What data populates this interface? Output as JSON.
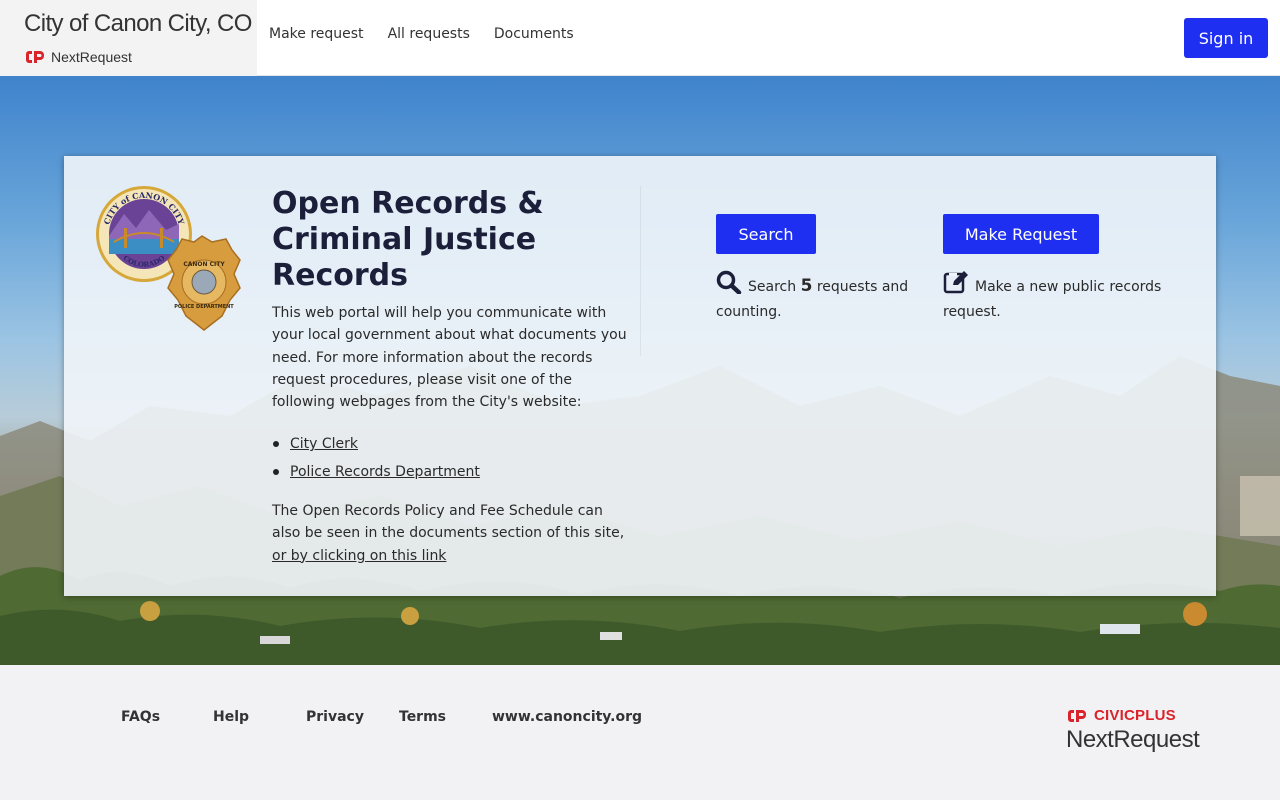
{
  "header": {
    "org_title": "City of Canon City, CO",
    "product_name": "NextRequest",
    "nav": [
      {
        "label": "Make request"
      },
      {
        "label": "All requests"
      },
      {
        "label": "Documents"
      }
    ],
    "signin_label": "Sign in"
  },
  "hero": {
    "title": "Open Records & Criminal Justice Records",
    "intro": "This web portal will help you communicate with your local government about what documents you need. For more information about the records request procedures, please visit one of the following webpages from the City's website:",
    "links": [
      {
        "label": "City Clerk"
      },
      {
        "label": "Police Records Department"
      }
    ],
    "policy_text": "The Open Records Policy and Fee Schedule can also be seen in the documents section of this site, ",
    "policy_link": "or by clicking on this link",
    "seal_text": {
      "city_top": "CITY of CANON CITY",
      "city_bottom": "COLORADO",
      "badge_top": "CANON CITY",
      "badge_bottom": "POLICE DEPARTMENT"
    }
  },
  "actions": {
    "search_button": "Search",
    "search_prefix": "Search",
    "search_count": "5",
    "search_suffix": "requests and counting.",
    "make_button": "Make Request",
    "make_desc": "Make a new public records request.",
    "search_icon": "magnifier-icon",
    "make_icon": "edit-icon"
  },
  "footer": {
    "links": [
      {
        "label": "FAQs"
      },
      {
        "label": "Help"
      },
      {
        "label": "Privacy"
      },
      {
        "label": "Terms"
      },
      {
        "label": "www.canoncity.org"
      }
    ],
    "brand_top": "CIVICPLUS",
    "brand_bottom": "NextRequest"
  },
  "colors": {
    "primary_button": "#1f2ff2",
    "brand_red": "#d9242b"
  }
}
